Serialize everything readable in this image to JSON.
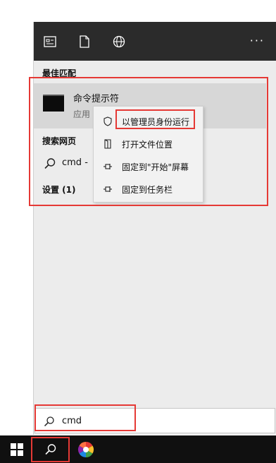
{
  "topbar": {
    "icons": [
      "apps-icon",
      "document-icon",
      "globe-icon"
    ],
    "more_label": "···"
  },
  "sections": {
    "best_match": "最佳匹配",
    "web_search": "搜索网页",
    "settings": "设置 (1)"
  },
  "best_match": {
    "title": "命令提示符",
    "subtitle": "应用"
  },
  "web_search_row": {
    "text": "cmd -"
  },
  "context_menu": {
    "items": [
      {
        "label": "以管理员身份运行",
        "icon": "shield-icon"
      },
      {
        "label": "打开文件位置",
        "icon": "folder-open-icon"
      },
      {
        "label": "固定到\"开始\"屏幕",
        "icon": "pin-icon"
      },
      {
        "label": "固定到任务栏",
        "icon": "pin-icon"
      }
    ]
  },
  "search": {
    "value": "cmd"
  },
  "colors": {
    "highlight": "#e53935",
    "topbar": "#2b2b2b",
    "taskbar": "#101010"
  }
}
